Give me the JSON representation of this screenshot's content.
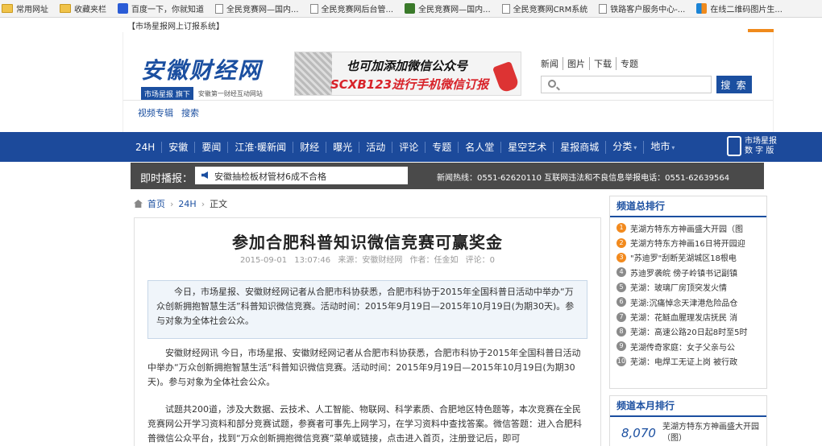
{
  "bookmarks": [
    {
      "icon": "folder-icon",
      "label": "常用网址"
    },
    {
      "icon": "folder-icon",
      "label": "收藏夹栏"
    },
    {
      "icon": "paw-icon",
      "label": "百度一下，你就知道"
    },
    {
      "icon": "page-icon",
      "label": "全民竞赛网—国内..."
    },
    {
      "icon": "page-icon",
      "label": "全民竞赛网后台管..."
    },
    {
      "icon": "js-icon",
      "label": "全民竞赛网—国内..."
    },
    {
      "icon": "page-icon",
      "label": "全民竞赛网CRM系统"
    },
    {
      "icon": "page-icon",
      "label": "铁路客户服务中心-..."
    },
    {
      "icon": "qr-icon",
      "label": "在线二维码图片生..."
    }
  ],
  "top_link": "【市场星报网上订报系统】",
  "logo": {
    "title": "安徽财经网",
    "badge": "市场星报 旗下",
    "slogan": "安徽第一财经互动网站"
  },
  "banner": {
    "line1": "也可加添加微信公众号",
    "line2": "SCXB123进行手机微信订报"
  },
  "sub_nav": [
    "新闻",
    "图片",
    "下载",
    "专题"
  ],
  "search": {
    "placeholder": "",
    "button": "搜 索"
  },
  "quick_links": [
    "视频专辑",
    "搜索"
  ],
  "main_nav": [
    {
      "label": "24H"
    },
    {
      "label": "安徽"
    },
    {
      "label": "要闻"
    },
    {
      "label": "江淮·暖新闻"
    },
    {
      "label": "财经"
    },
    {
      "label": "曝光"
    },
    {
      "label": "活动"
    },
    {
      "label": "评论"
    },
    {
      "label": "专题"
    },
    {
      "label": "名人堂"
    },
    {
      "label": "星空艺术"
    },
    {
      "label": "星报商城"
    },
    {
      "label": "分类",
      "dropdown": true
    },
    {
      "label": "地市",
      "dropdown": true
    }
  ],
  "digital": {
    "line1": "市场星报",
    "line2": "数 字 版"
  },
  "ticker": {
    "label": "即时播报：",
    "text": "安徽抽检板材管材6成不合格",
    "hotline": "新闻热线：0551-62620110   互联网违法和不良信息举报电话：0551-62639564"
  },
  "breadcrumb": {
    "home": "首页",
    "section": "24H",
    "current": "正文"
  },
  "article": {
    "title": "参加合肥科普知识微信竞赛可赢奖金",
    "meta": "2015-09-01 13:07:46   来源：安徽财经网   作者：任金如   评论：0",
    "summary": "今日，市场星报、安徽财经网记者从合肥市科协获悉，合肥市科协于2015年全国科普日活动中举办“万众创新拥抱智慧生活”科普知识微信竞赛。活动时间：2015年9月19日—2015年10月19日(为期30天)。参与对象为全体社会公众。",
    "p1": "安徽财经网讯  今日，市场星报、安徽财经网记者从合肥市科协获悉，合肥市科协于2015年全国科普日活动中举办“万众创新拥抱智慧生活”科普知识微信竞赛。活动时间：2015年9月19日—2015年10月19日(为期30天)。参与对象为全体社会公众。",
    "p2": "试题共200道，涉及大数据、云技术、人工智能、物联网、科学素质、合肥地区特色题等，本次竞赛在全民竞赛网公开学习资料和部分竞赛试题，参赛者可事先上网学习，在学习资料中查找答案。微信答题：进入合肥科普微信公众平台，找到“万众创新拥抱微信竞赛”菜单或链接，点击进入首页，注册登记后，即可"
  },
  "rank_total": {
    "title": "频道总排行",
    "items": [
      {
        "n": "1",
        "text": "芜湖方特东方神画盛大开园（图"
      },
      {
        "n": "2",
        "text": "芜湖方特东方神画16日将开园迎"
      },
      {
        "n": "3",
        "text": "\"苏迪罗\"刮断芜湖城区18根电"
      },
      {
        "n": "4",
        "text": "苏迪罗袭皖 傍子岭镇书记副镇"
      },
      {
        "n": "5",
        "text": "芜湖：玻璃厂房顶突发火情"
      },
      {
        "n": "6",
        "text": "芜湖:沉痛悼念天津港危险品仓"
      },
      {
        "n": "7",
        "text": "芜湖：花鲢血腥理发店抚民 消"
      },
      {
        "n": "8",
        "text": "芜湖：高速公路20日起8时至5时"
      },
      {
        "n": "9",
        "text": "芜湖传奇家庭：女子父亲与公"
      },
      {
        "n": "10",
        "text": "芜湖：电焊工无证上岗 被行政"
      }
    ]
  },
  "rank_month": {
    "title": "频道本月排行",
    "items": [
      {
        "views": "8,070",
        "text": "芜湖方特东方神画盛大开园（图）"
      }
    ]
  }
}
